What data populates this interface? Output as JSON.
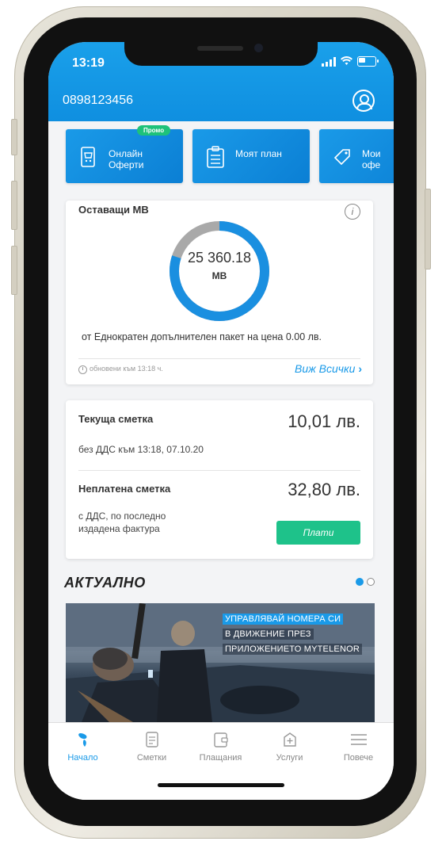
{
  "status": {
    "time": "13:19"
  },
  "header": {
    "phone_number": "0898123456"
  },
  "offers": [
    {
      "label": "Онлайн Оферти",
      "badge": "Промо"
    },
    {
      "label": "Моят план"
    },
    {
      "label": "Мои офе"
    }
  ],
  "data_card": {
    "title": "Оставащи МВ",
    "remaining_value": "25 360.18",
    "remaining_unit": "MB",
    "remaining_fraction": 0.8,
    "description": "от Еднократен допълнителен пакет на цена 0.00 лв.",
    "updated": "обновени към 13:18 ч.",
    "view_all": "Виж Всички"
  },
  "bill_card": {
    "current_label": "Текуща сметка",
    "current_amount": "10,01 лв.",
    "current_sub": "без ДДС към 13:18, 07.10.20",
    "unpaid_label": "Неплатена сметка",
    "unpaid_amount": "32,80 лв.",
    "unpaid_sub": "с ДДС, по последно издадена фактура",
    "pay_button": "Плати"
  },
  "news": {
    "title": "АКТУАЛНО",
    "banner_lines": [
      "УПРАВЛЯВАЙ НОМЕРА СИ",
      "В ДВИЖЕНИЕ ПРЕЗ",
      "ПРИЛОЖЕНИЕТО MYTELENOR"
    ]
  },
  "tabs": [
    {
      "label": "Начало",
      "active": true
    },
    {
      "label": "Сметки"
    },
    {
      "label": "Плащания"
    },
    {
      "label": "Услуги"
    },
    {
      "label": "Повече"
    }
  ],
  "colors": {
    "accent": "#1a9ae8",
    "pay_button": "#1ec28a",
    "donut_remaining": "#1a8fe0",
    "donut_used": "#a9a9a9"
  }
}
